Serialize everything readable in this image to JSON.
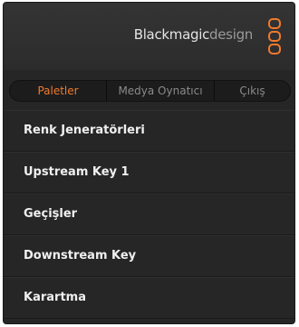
{
  "header": {
    "brand_part1": "Blackmagic",
    "brand_part2": "design",
    "logo_icon": "blackmagic-logo-icon"
  },
  "tabs": [
    {
      "label": "Paletler",
      "active": true
    },
    {
      "label": "Medya Oynatıcı",
      "active": false
    },
    {
      "label": "Çıkış",
      "active": false
    }
  ],
  "menu": {
    "items": [
      {
        "label": "Renk Jeneratörleri"
      },
      {
        "label": "Upstream Key 1"
      },
      {
        "label": "Geçişler"
      },
      {
        "label": "Downstream Key"
      },
      {
        "label": "Karartma"
      }
    ]
  },
  "colors": {
    "accent": "#f07a2e",
    "panel_background": "#262626",
    "menu_text": "#f0f0f0",
    "inactive_tab_text": "#8a8a8a"
  }
}
